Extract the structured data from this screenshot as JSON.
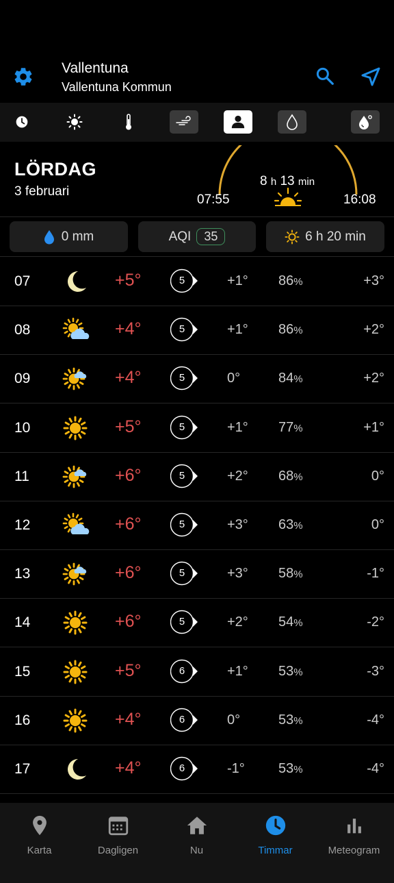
{
  "header": {
    "location": "Vallentuna",
    "municipality": "Vallentuna Kommun"
  },
  "filters": [
    {
      "icon": "clock-icon"
    },
    {
      "icon": "sun-icon"
    },
    {
      "icon": "thermometer-icon"
    },
    {
      "icon": "wind-icon",
      "active": true
    },
    {
      "icon": "person-icon",
      "active": true
    },
    {
      "icon": "drop-icon",
      "active": true
    },
    {
      "icon": "humidity-icon",
      "active": true
    }
  ],
  "day": {
    "name": "LÖRDAG",
    "date": "3 februari",
    "sunrise": "07:55",
    "sunset": "16:08",
    "daylength_h": "8",
    "h_unit": "h",
    "daylength_min": "13",
    "min_unit": "min"
  },
  "stats": {
    "precip": "0 mm",
    "aqi_label": "AQI",
    "aqi_value": "35",
    "sun_hours": "6 h 20 min"
  },
  "rows": [
    {
      "hour": "07",
      "icon": "moon",
      "temp": "+5°",
      "wind": "5",
      "dew": "+1°",
      "hum": "86",
      "feel": "+3°"
    },
    {
      "hour": "08",
      "icon": "sun-cloud",
      "temp": "+4°",
      "wind": "5",
      "dew": "+1°",
      "hum": "86",
      "feel": "+2°"
    },
    {
      "hour": "09",
      "icon": "sun-small-cloud",
      "temp": "+4°",
      "wind": "5",
      "dew": "0°",
      "hum": "84",
      "feel": "+2°"
    },
    {
      "hour": "10",
      "icon": "sun",
      "temp": "+5°",
      "wind": "5",
      "dew": "+1°",
      "hum": "77",
      "feel": "+1°"
    },
    {
      "hour": "11",
      "icon": "sun-small-cloud",
      "temp": "+6°",
      "wind": "5",
      "dew": "+2°",
      "hum": "68",
      "feel": "0°"
    },
    {
      "hour": "12",
      "icon": "sun-cloud",
      "temp": "+6°",
      "wind": "5",
      "dew": "+3°",
      "hum": "63",
      "feel": "0°"
    },
    {
      "hour": "13",
      "icon": "sun-small-cloud",
      "temp": "+6°",
      "wind": "5",
      "dew": "+3°",
      "hum": "58",
      "feel": "-1°"
    },
    {
      "hour": "14",
      "icon": "sun",
      "temp": "+6°",
      "wind": "5",
      "dew": "+2°",
      "hum": "54",
      "feel": "-2°"
    },
    {
      "hour": "15",
      "icon": "sun",
      "temp": "+5°",
      "wind": "6",
      "dew": "+1°",
      "hum": "53",
      "feel": "-3°"
    },
    {
      "hour": "16",
      "icon": "sun",
      "temp": "+4°",
      "wind": "6",
      "dew": "0°",
      "hum": "53",
      "feel": "-4°"
    },
    {
      "hour": "17",
      "icon": "moon",
      "temp": "+4°",
      "wind": "6",
      "dew": "-1°",
      "hum": "53",
      "feel": "-4°"
    }
  ],
  "hum_unit": "%",
  "nav": [
    {
      "label": "Karta",
      "icon": "map-pin-icon"
    },
    {
      "label": "Dagligen",
      "icon": "calendar-icon"
    },
    {
      "label": "Nu",
      "icon": "home-icon"
    },
    {
      "label": "Timmar",
      "icon": "clock-icon",
      "active": true
    },
    {
      "label": "Meteogram",
      "icon": "bar-chart-icon"
    }
  ],
  "colors": {
    "accent": "#1e8ee8",
    "temp": "#e05252",
    "sun": "#f5b50e",
    "background": "#000000"
  }
}
